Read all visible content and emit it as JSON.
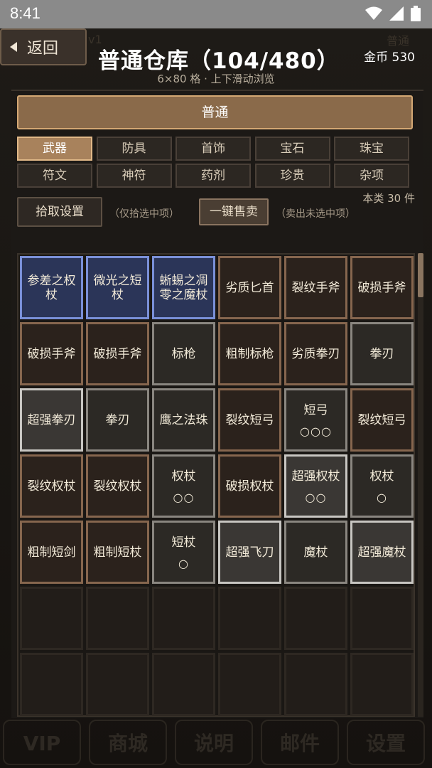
{
  "status": {
    "time": "8:41"
  },
  "nav": {
    "back_label": "返回"
  },
  "header": {
    "title": "普通仓库（104/480）",
    "subtitle": "6×80 格 · 上下滑动浏览",
    "gold": "金币 530"
  },
  "category_bar": {
    "label": "普通"
  },
  "tabs": [
    {
      "label": "武器",
      "active": true
    },
    {
      "label": "防具",
      "active": false
    },
    {
      "label": "首饰",
      "active": false
    },
    {
      "label": "宝石",
      "active": false
    },
    {
      "label": "珠宝",
      "active": false
    },
    {
      "label": "符文",
      "active": false
    },
    {
      "label": "神符",
      "active": false
    },
    {
      "label": "药剂",
      "active": false
    },
    {
      "label": "珍贵",
      "active": false
    },
    {
      "label": "杂项",
      "active": false
    }
  ],
  "category_count": "本类 30 件",
  "actions": {
    "pickup_settings": "拾取设置",
    "pickup_hint": "（仅拾选中项）",
    "sell_all": "一键售卖",
    "sell_hint": "（卖出未选中项）"
  },
  "items": [
    {
      "name": "参差之权杖",
      "quality": "blue",
      "dots": ""
    },
    {
      "name": "微光之短杖",
      "quality": "blue",
      "dots": ""
    },
    {
      "name": "蜥蜴之凋零之魔杖",
      "quality": "blue",
      "dots": ""
    },
    {
      "name": "劣质匕首",
      "quality": "brown",
      "dots": ""
    },
    {
      "name": "裂纹手斧",
      "quality": "brown",
      "dots": ""
    },
    {
      "name": "破损手斧",
      "quality": "brown",
      "dots": ""
    },
    {
      "name": "破损手斧",
      "quality": "brown",
      "dots": ""
    },
    {
      "name": "破损手斧",
      "quality": "brown",
      "dots": ""
    },
    {
      "name": "标枪",
      "quality": "gray",
      "dots": ""
    },
    {
      "name": "粗制标枪",
      "quality": "brown",
      "dots": ""
    },
    {
      "name": "劣质拳刃",
      "quality": "brown",
      "dots": ""
    },
    {
      "name": "拳刃",
      "quality": "gray",
      "dots": ""
    },
    {
      "name": "超强拳刃",
      "quality": "white",
      "dots": ""
    },
    {
      "name": "拳刃",
      "quality": "gray",
      "dots": ""
    },
    {
      "name": "鹰之法珠",
      "quality": "gray",
      "dots": ""
    },
    {
      "name": "裂纹短弓",
      "quality": "brown",
      "dots": ""
    },
    {
      "name": "短弓",
      "quality": "gray",
      "dots": "○○○"
    },
    {
      "name": "裂纹短弓",
      "quality": "brown",
      "dots": ""
    },
    {
      "name": "裂纹权杖",
      "quality": "brown",
      "dots": ""
    },
    {
      "name": "裂纹权杖",
      "quality": "brown",
      "dots": ""
    },
    {
      "name": "权杖",
      "quality": "gray",
      "dots": "○○"
    },
    {
      "name": "破损权杖",
      "quality": "brown",
      "dots": ""
    },
    {
      "name": "超强权杖",
      "quality": "white",
      "dots": "○○"
    },
    {
      "name": "权杖",
      "quality": "gray",
      "dots": "○"
    },
    {
      "name": "粗制短剑",
      "quality": "brown",
      "dots": ""
    },
    {
      "name": "粗制短杖",
      "quality": "brown",
      "dots": ""
    },
    {
      "name": "短杖",
      "quality": "gray",
      "dots": "○"
    },
    {
      "name": "超强飞刀",
      "quality": "white",
      "dots": ""
    },
    {
      "name": "魔杖",
      "quality": "gray",
      "dots": ""
    },
    {
      "name": "超强魔杖",
      "quality": "white",
      "dots": ""
    }
  ],
  "empty_slots": 12,
  "background": {
    "ghost_version": "v1",
    "ghost_right": "普通",
    "bottom_tabs": [
      "VIP",
      "商城",
      "说明",
      "邮件",
      "设置"
    ]
  },
  "colors": {
    "accent": "#a8825c",
    "quality_blue": "#7a90d8",
    "quality_white": "#c8c6c2",
    "quality_gray": "#8a8680",
    "quality_brown": "#86664e"
  }
}
